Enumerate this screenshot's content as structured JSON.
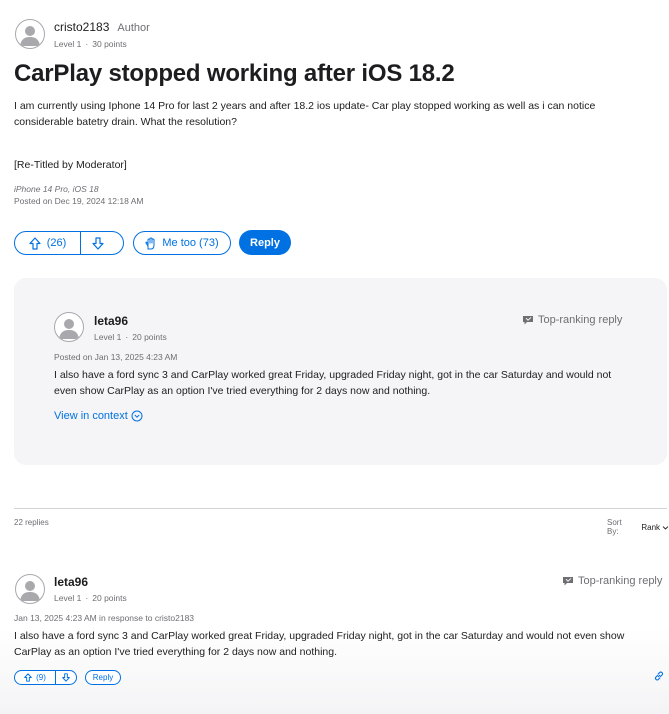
{
  "question": {
    "author": {
      "name": "cristo2183",
      "badge": "Author",
      "level": "Level 1",
      "points": "30 points"
    },
    "title": "CarPlay stopped working after iOS 18.2",
    "body": "I am currently using Iphone 14 Pro for last 2 years and after 18.2 ios update- Car play stopped working as well as i can notice considerable batetry drain. What the resolution?",
    "moderator_note": "[Re-Titled by Moderator]",
    "device": "iPhone 14 Pro, iOS 18",
    "posted": "Posted on Dec 19, 2024 12:18 AM",
    "actions": {
      "upvote_count": "(26)",
      "me_too_label": "Me too (73)",
      "reply_label": "Reply"
    }
  },
  "top_reply_card": {
    "author": {
      "name": "leta96",
      "level": "Level 1",
      "points": "20 points"
    },
    "badge": "Top-ranking reply",
    "posted": "Posted on Jan 13, 2025 4:23 AM",
    "body": "I also have a ford sync 3 and CarPlay worked great Friday, upgraded Friday night, got in the car Saturday and would not even show CarPlay as an option I've tried everything for 2 days now and nothing.",
    "view_in_context": "View in context"
  },
  "replies_bar": {
    "count_label": "22 replies",
    "sort_label": "Sort By:",
    "sort_value": "Rank"
  },
  "reply": {
    "author": {
      "name": "leta96",
      "level": "Level 1",
      "points": "20 points"
    },
    "badge": "Top-ranking reply",
    "posted": "Jan 13, 2025 4:23 AM in response to cristo2183",
    "body": "I also have a ford sync 3 and CarPlay worked great Friday, upgraded Friday night, got in the car Saturday and would not even show CarPlay as an option I've tried everything for 2 days now and nothing.",
    "upvote_count": "(9)",
    "reply_label": "Reply"
  },
  "colors": {
    "accent": "#0071e3",
    "card_bg": "#f5f5f7",
    "muted_text": "#6e6e73"
  }
}
